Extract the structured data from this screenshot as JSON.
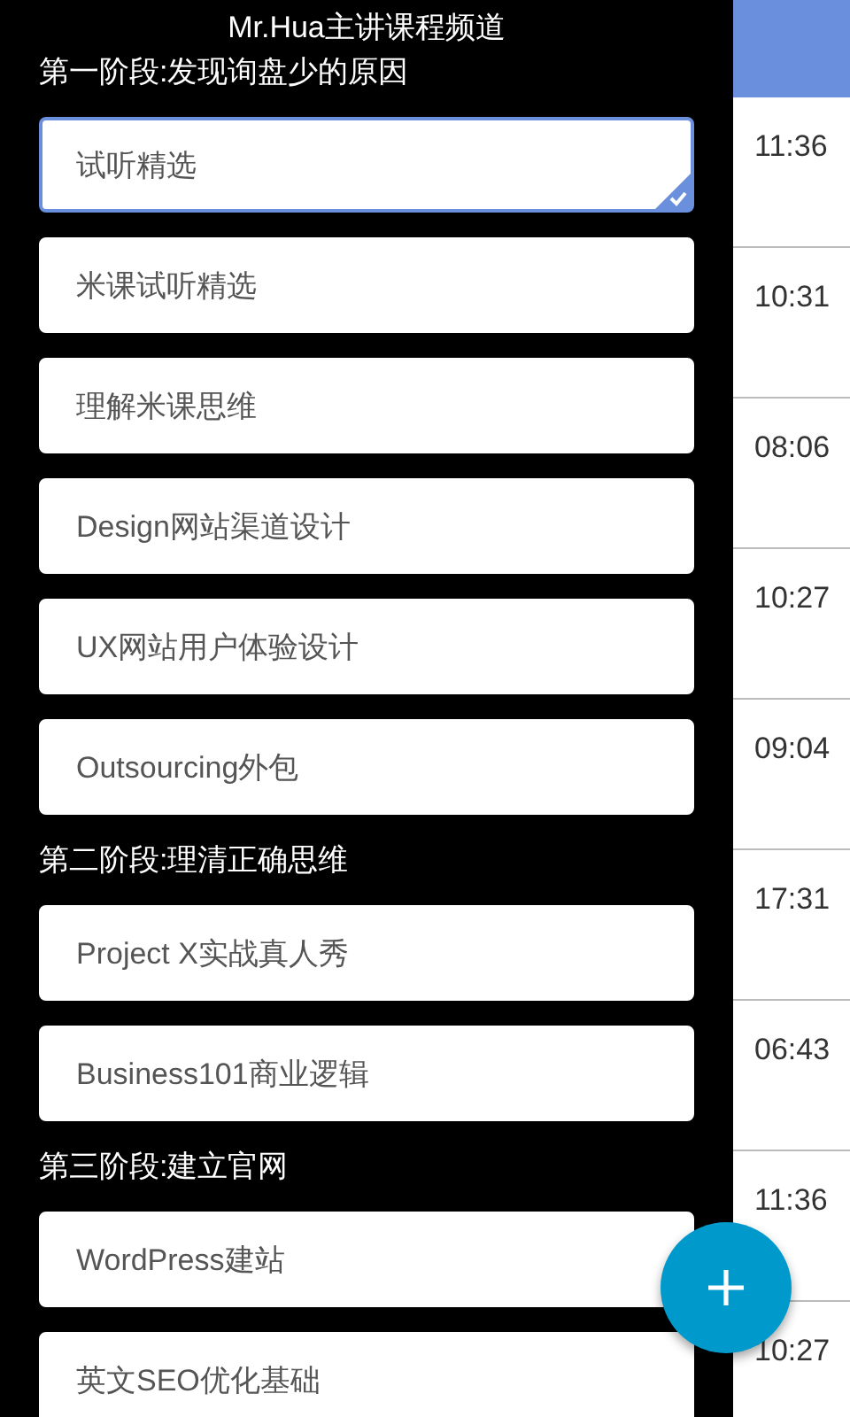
{
  "drawer": {
    "title": "Mr.Hua主讲课程频道",
    "sections": [
      {
        "heading": "第一阶段:发现询盘少的原因",
        "items": [
          {
            "label": "试听精选",
            "selected": true
          },
          {
            "label": "米课试听精选",
            "selected": false
          },
          {
            "label": "理解米课思维",
            "selected": false
          },
          {
            "label": "Design网站渠道设计",
            "selected": false
          },
          {
            "label": "UX网站用户体验设计",
            "selected": false
          },
          {
            "label": "Outsourcing外包",
            "selected": false
          }
        ]
      },
      {
        "heading": "第二阶段:理清正确思维",
        "items": [
          {
            "label": "Project X实战真人秀",
            "selected": false
          },
          {
            "label": "Business101商业逻辑",
            "selected": false
          }
        ]
      },
      {
        "heading": "第三阶段:建立官网",
        "items": [
          {
            "label": "WordPress建站",
            "selected": false
          },
          {
            "label": "英文SEO优化基础",
            "selected": false
          }
        ]
      }
    ]
  },
  "list": {
    "times": [
      "11:36",
      "10:31",
      "08:06",
      "10:27",
      "09:04",
      "17:31",
      "06:43",
      "11:36",
      "10:27"
    ]
  },
  "fab": {
    "kind": "add"
  }
}
